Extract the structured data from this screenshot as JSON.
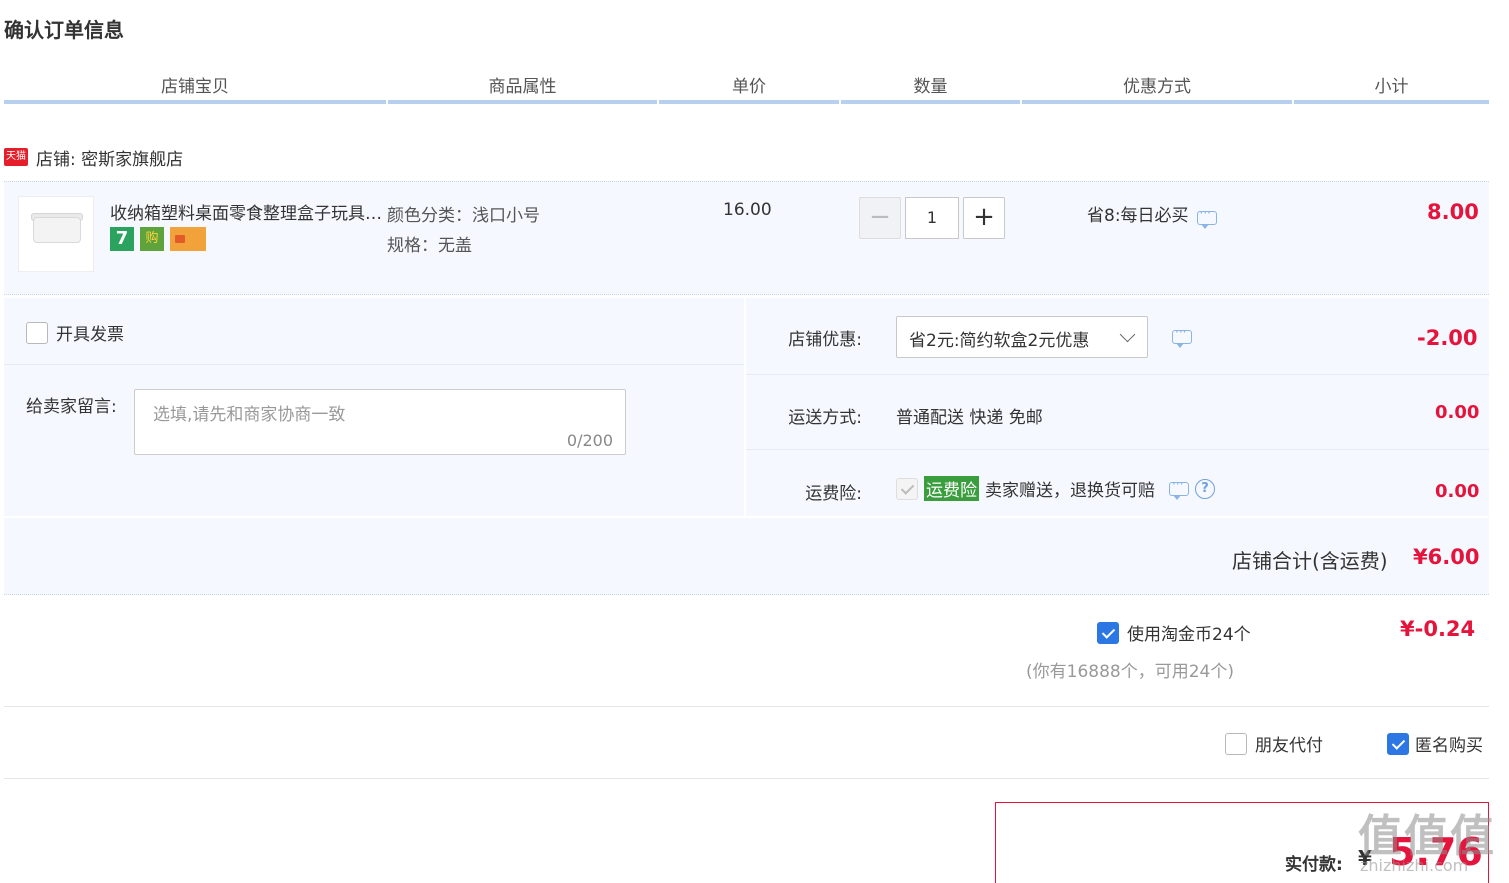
{
  "page_title": "确认订单信息",
  "columns": [
    "店铺宝贝",
    "商品属性",
    "单价",
    "数量",
    "优惠方式",
    "小计"
  ],
  "shop": {
    "badge": "天猫",
    "label": "店铺: 密斯家旗舰店"
  },
  "item": {
    "title": "收纳箱塑料桌面零食整理盒子玩具储物箱",
    "attr_color": "颜色分类：浅口小号",
    "attr_spec": "规格：无盖",
    "unit_price": "16.00",
    "quantity": "1",
    "minus": "−",
    "plus": "+",
    "promo": "省8:每日必买",
    "subtotal": "8.00",
    "badge_7": "7",
    "badge_shop": "购"
  },
  "invoice": {
    "label": "开具发票"
  },
  "message": {
    "label": "给卖家留言:",
    "placeholder": "选填,请先和商家协商一致",
    "count": "0/200"
  },
  "shop_discount": {
    "label": "店铺优惠:",
    "value": "省2元:简约软盒2元优惠",
    "amount": "-2.00"
  },
  "shipping": {
    "label": "运送方式:",
    "value": "普通配送 快递 免邮",
    "amount": "0.00"
  },
  "insurance": {
    "label": "运费险:",
    "tag": "运费险",
    "text": "卖家赠送，退换货可赔",
    "help": "?",
    "amount": "0.00"
  },
  "shop_total": {
    "label": "店铺合计(含运费)",
    "amount": "¥6.00"
  },
  "coins": {
    "label": "使用淘金币24个",
    "sub": "(你有16888个，可用24个)",
    "amount": "¥-0.24"
  },
  "friend_pay": {
    "label": "朋友代付"
  },
  "anonymous": {
    "label": "匿名购买"
  },
  "payment": {
    "label": "实付款:",
    "currency": "¥",
    "amount": "5.76"
  },
  "watermark": {
    "main": "值值值",
    "sub": "zhizhizhi.com"
  },
  "colors": {
    "accent_red": "#e4143c",
    "header_underline": "#b7d0ef",
    "panel_bg": "#f5f8fe",
    "check_blue": "#2d77e4"
  }
}
